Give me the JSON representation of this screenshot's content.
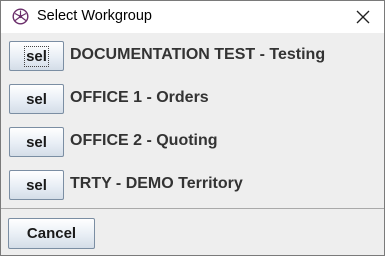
{
  "window": {
    "title": "Select Workgroup",
    "icon": "workgroup-app-icon",
    "close_icon": "close-icon"
  },
  "workgroups": [
    {
      "button_label": "sel",
      "name": "DOCUMENTATION TEST - Testing"
    },
    {
      "button_label": "sel",
      "name": "OFFICE 1 - Orders"
    },
    {
      "button_label": "sel",
      "name": "OFFICE 2 - Quoting"
    },
    {
      "button_label": "sel",
      "name": "TRTY - DEMO Territory"
    }
  ],
  "footer": {
    "cancel_label": "Cancel"
  },
  "colors": {
    "title_bar": "#ffffff",
    "panel": "#eeeeee",
    "label_text": "#333333",
    "button_border": "#7b8ea3"
  }
}
